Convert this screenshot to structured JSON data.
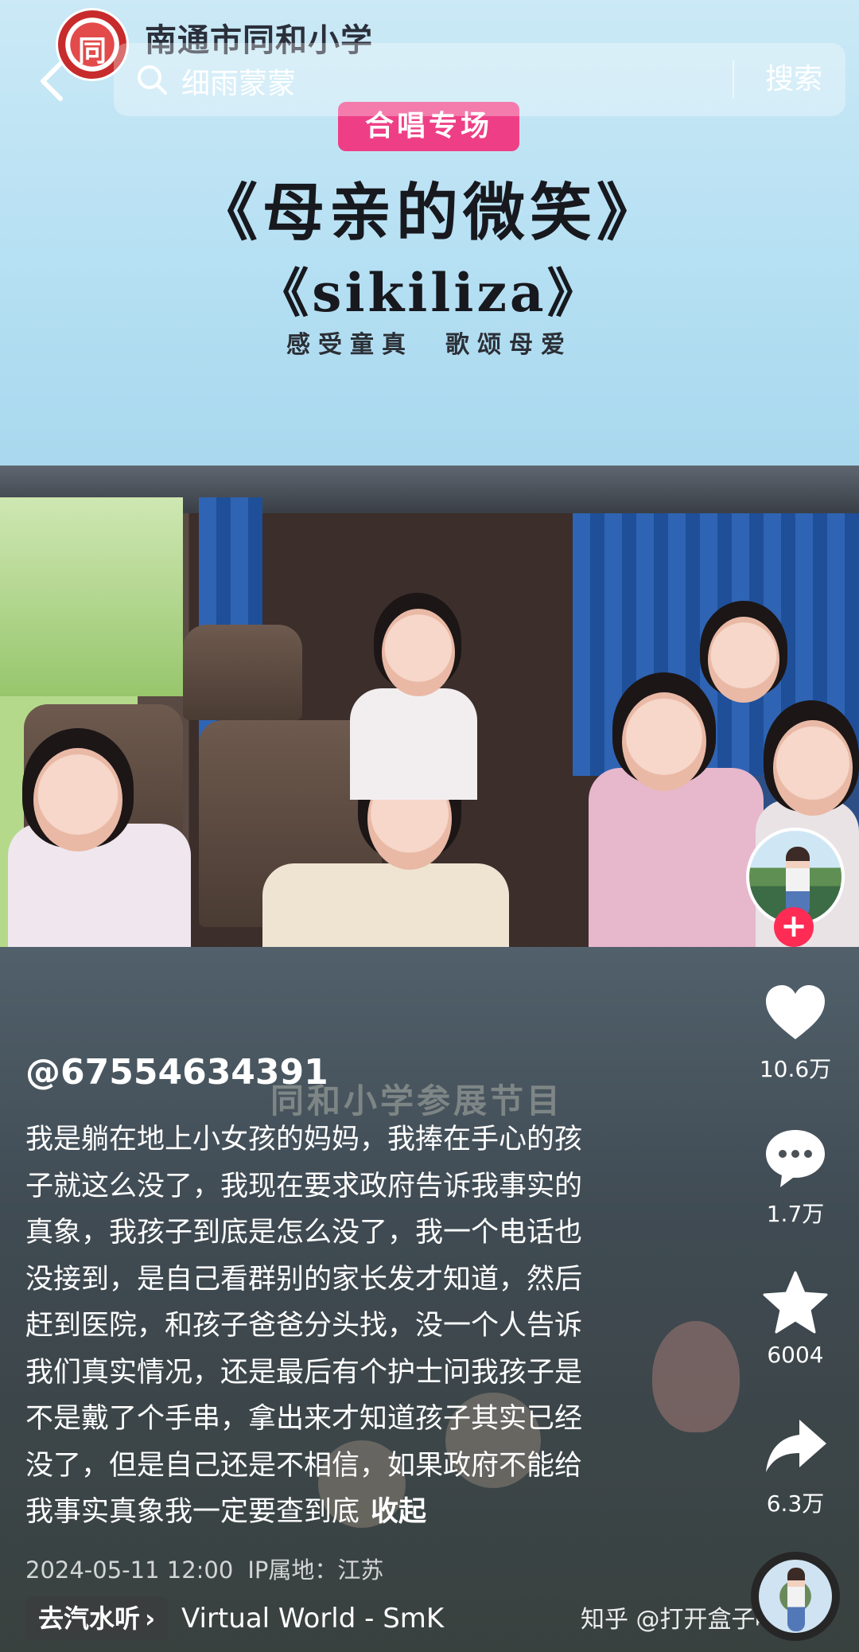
{
  "video": {
    "school_name": "南通市同和小学",
    "logo_glyph": "同",
    "tag": "合唱专场",
    "title_1": "《母亲的微笑》",
    "title_2": "《sikiliza》",
    "slogan": "感受童真　歌颂母爱",
    "faint_caption": "同和小学参展节目"
  },
  "search": {
    "placeholder": "细雨蒙蒙",
    "button": "搜索"
  },
  "actions": {
    "likes": "10.6万",
    "comments": "1.7万",
    "favorites": "6004",
    "shares": "6.3万",
    "follow_symbol": "+"
  },
  "post": {
    "username": "@67554634391",
    "caption_lines": [
      "我是躺在地上小女孩的妈妈，我捧在手心的孩",
      "子就这么没了，我现在要求政府告诉我事实的",
      "真象，我孩子到底是怎么没了，我一个电话也",
      "没接到，是自己看群别的家长发才知道，然后",
      "赶到医院，和孩子爸爸分头找，没一个人告诉",
      "我们真实情况，还是最后有个护士问我孩子是",
      "不是戴了个手串，拿出来才知道孩子其实已经",
      "没了，但是自己还是不相信，如果政府不能给",
      "我事实真象我一定要查到底"
    ],
    "collapse_label": "收起",
    "date": "2024-05-11 12:00",
    "ip_location": "IP属地：江苏"
  },
  "music": {
    "pill_label": "去汽水听",
    "chevron": "›",
    "title": "Virtual World - SmK"
  },
  "watermark": "知乎 @打开盒子吓一跳",
  "colors": {
    "follow_red": "#fe2c55",
    "tag_pink": "#ee3f86"
  },
  "icons": [
    "back-arrow-icon",
    "search-icon",
    "heart-icon",
    "comment-icon",
    "star-icon",
    "share-icon"
  ]
}
